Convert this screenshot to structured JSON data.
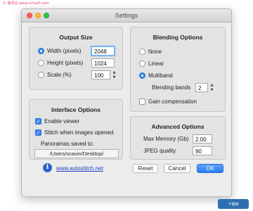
{
  "window": {
    "title": "Settings"
  },
  "output_size": {
    "title": "Output Size",
    "options": [
      {
        "label": "Width (pixels)",
        "value": "2048",
        "selected": true
      },
      {
        "label": "Height (pixels)",
        "value": "1024",
        "selected": false
      },
      {
        "label": "Scale (%)",
        "value": "100",
        "selected": false
      }
    ]
  },
  "blending": {
    "title": "Blending Options",
    "options": [
      "None",
      "Linear",
      "Multiband"
    ],
    "selected": "Multiband",
    "bands_label": "Blending bands",
    "bands_value": "2",
    "gain_label": "Gain compensation",
    "gain_checked": false
  },
  "interface": {
    "title": "Interface Options",
    "enable_viewer_label": "Enable viewer",
    "enable_viewer_checked": true,
    "stitch_label": "Stitch when images opened",
    "stitch_checked": true,
    "saved_label": "Panoramas saved to:",
    "saved_path": "/Users/scavin/Desktop/"
  },
  "advanced": {
    "title": "Advanced Options",
    "max_memory_label": "Max Memory (Gb)",
    "max_memory_value": "2.00",
    "jpeg_label": "JPEG quality",
    "jpeg_value": "90"
  },
  "footer": {
    "link": "www.autostitch.net",
    "reset": "Reset",
    "cancel": "Cancel",
    "ok": "OK"
  },
  "watermark": {
    "top": "© 晨风云 www.cnfsoft.com",
    "badge": "下载吧"
  },
  "colors": {
    "accent": "#3a86f0",
    "link": "#1d3fc2",
    "info_icon": "#2f64c7"
  }
}
